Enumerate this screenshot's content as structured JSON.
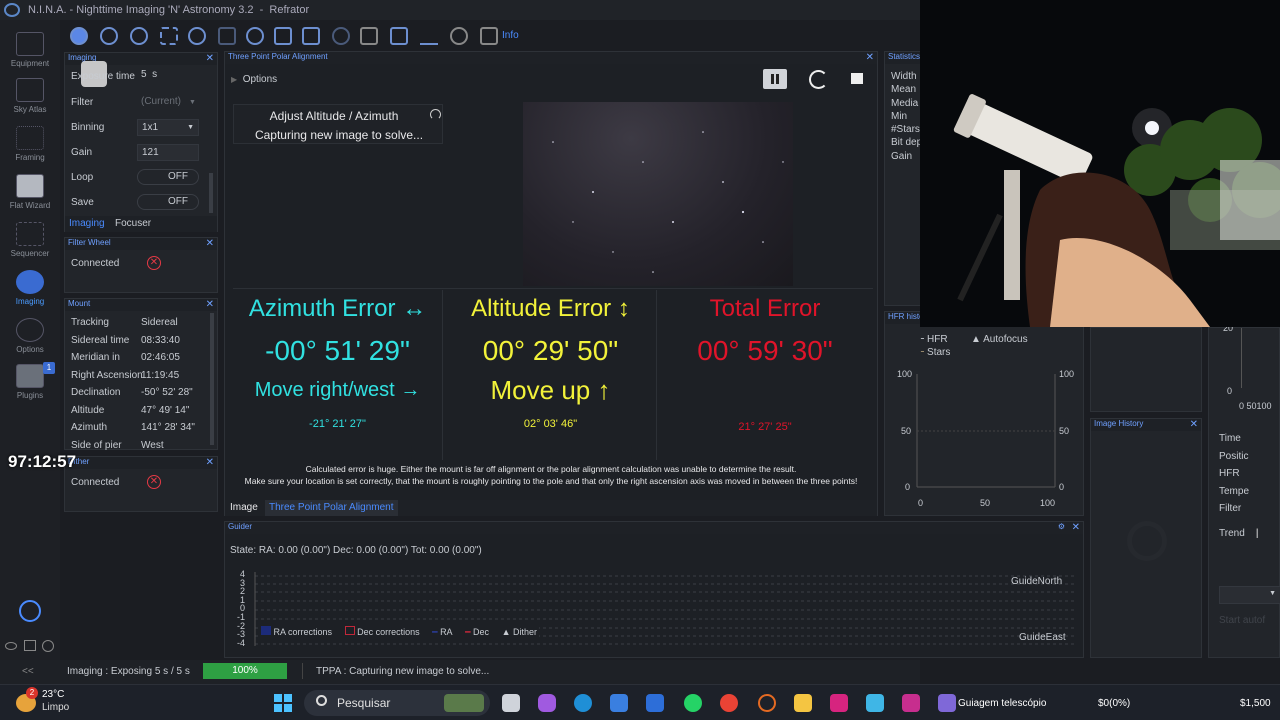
{
  "app": {
    "title": "N.I.N.A. - Nighttime Imaging 'N' Astronomy 3.2",
    "profile": "Refrator"
  },
  "nav": [
    {
      "label": "Equipment",
      "icon": "equipment-icon"
    },
    {
      "label": "Sky Atlas",
      "icon": "sky-atlas-icon"
    },
    {
      "label": "Framing",
      "icon": "framing-icon"
    },
    {
      "label": "Flat Wizard",
      "icon": "flat-wizard-icon"
    },
    {
      "label": "Sequencer",
      "icon": "sequencer-icon"
    },
    {
      "label": "Imaging",
      "icon": "imaging-icon"
    },
    {
      "label": "Options",
      "icon": "options-icon"
    },
    {
      "label": "Plugins",
      "icon": "plugins-icon",
      "badge": "1"
    }
  ],
  "toolbar": {
    "info_label": "Info"
  },
  "imaging_panel": {
    "title": "Imaging",
    "rows": [
      {
        "label": "Exposure time",
        "value": "5",
        "unit": "s"
      },
      {
        "label": "Filter",
        "value": "(Current)"
      },
      {
        "label": "Binning",
        "value": "1x1"
      },
      {
        "label": "Gain",
        "value": "121"
      },
      {
        "label": "Loop",
        "value": "OFF"
      },
      {
        "label": "Save",
        "value": "OFF"
      }
    ],
    "tabs": [
      "Imaging",
      "Focuser"
    ]
  },
  "filter_wheel": {
    "title": "Filter Wheel",
    "status": "Connected"
  },
  "mount": {
    "title": "Mount",
    "rows": [
      {
        "label": "Tracking",
        "value": "Sidereal"
      },
      {
        "label": "Sidereal time",
        "value": "08:33:40"
      },
      {
        "label": "Meridian in",
        "value": "02:46:05"
      },
      {
        "label": "Right Ascension",
        "value": "11:19:45"
      },
      {
        "label": "Declination",
        "value": "-50° 52' 28\""
      },
      {
        "label": "Altitude",
        "value": "47° 49' 14\""
      },
      {
        "label": "Azimuth",
        "value": "141° 28' 34\""
      },
      {
        "label": "Side of pier",
        "value": "West"
      }
    ]
  },
  "dither": {
    "title": "Dither",
    "status": "Connected"
  },
  "overlay_timer": "97:12:57",
  "tppa": {
    "title": "Three Point Polar Alignment",
    "options_label": "Options",
    "step_title": "Adjust Altitude / Azimuth",
    "step_status": "Capturing new image to solve...",
    "azimuth": {
      "title": "Azimuth Error",
      "value": "-00° 51' 29\"",
      "move": "Move right/west",
      "detail": "-21° 21' 27\""
    },
    "altitude": {
      "title": "Altitude Error",
      "value": "00° 29' 50\"",
      "move": "Move up",
      "detail": "02° 03' 46\""
    },
    "total": {
      "title": "Total Error",
      "value": "00° 59' 30\"",
      "detail": "21° 27' 25\""
    },
    "warning1": "Calculated error is huge. Either the mount is far off alignment or the polar alignment calculation was unable to determine the result.",
    "warning2": "Make sure your location is set correctly, that the mount is roughly pointing to the pole and that only the right ascension axis was moved in between the three points!",
    "tabs": [
      "Image",
      "Three Point Polar Alignment"
    ]
  },
  "statistics": {
    "title": "Statistics",
    "labels": [
      "Width",
      "Mean",
      "Media",
      "Min",
      "#Stars",
      "Bit dep",
      "Gain"
    ]
  },
  "hfr_history": {
    "title": "HFR histo",
    "legend": [
      "HFR",
      "Autofocus",
      "Stars"
    ],
    "y_ticks": [
      "100",
      "50",
      "0"
    ],
    "x_ticks": [
      "0",
      "50",
      "100"
    ]
  },
  "image_history": {
    "title": "Image History"
  },
  "right_panel": {
    "labels": [
      "Time",
      "Positic",
      "HFR",
      "Tempe",
      "Filter",
      "Trend"
    ],
    "axis": [
      "20",
      "0"
    ],
    "axis_x": "0 50100",
    "start_label": "Start autof"
  },
  "guider": {
    "title": "Guider",
    "state": "State:  RA: 0.00 (0.00\")  Dec: 0.00 (0.00\")  Tot: 0.00 (0.00\")",
    "y_ticks": [
      "4",
      "3",
      "2",
      "1",
      "0",
      "-1",
      "-2",
      "-3",
      "-4"
    ],
    "north": "GuideNorth",
    "east": "GuideEast",
    "legend": [
      "RA corrections",
      "Dec corrections",
      "RA",
      "Dec",
      "Dither"
    ]
  },
  "status": {
    "imaging": "Imaging :   Exposing 5 s / 5 s",
    "progress": "100%",
    "progress_fraction": 1.0,
    "tppa": "TPPA :   Capturing new image to solve..."
  },
  "taskbar": {
    "weather_temp": "23°C",
    "weather_desc": "Limpo",
    "weather_badge": "2",
    "search": "Pesquisar",
    "window_label": "Guiagem telescópio",
    "price1": "$0(0%)",
    "price2": "$1,500"
  },
  "colors": {
    "cyan": "#31e1e1",
    "yellow": "#f2f23a",
    "red": "#e0142a",
    "accent": "#4a8bff"
  }
}
